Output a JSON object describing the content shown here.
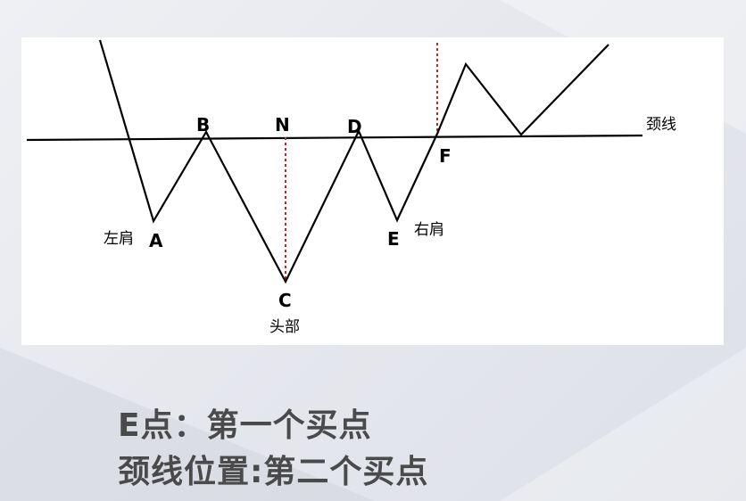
{
  "diagram": {
    "points": {
      "A": "A",
      "B": "B",
      "C": "C",
      "D": "D",
      "E": "E",
      "F": "F",
      "N": "N"
    },
    "labels": {
      "left_shoulder": "左肩",
      "head": "头部",
      "right_shoulder": "右肩",
      "neckline": "颈线"
    },
    "colors": {
      "line": "#000000",
      "marker": "#cc2222",
      "caption_text": "#4a4a4a"
    }
  },
  "captions": {
    "line1": "E点：第一个买点",
    "line2": "颈线位置:第二个买点"
  }
}
